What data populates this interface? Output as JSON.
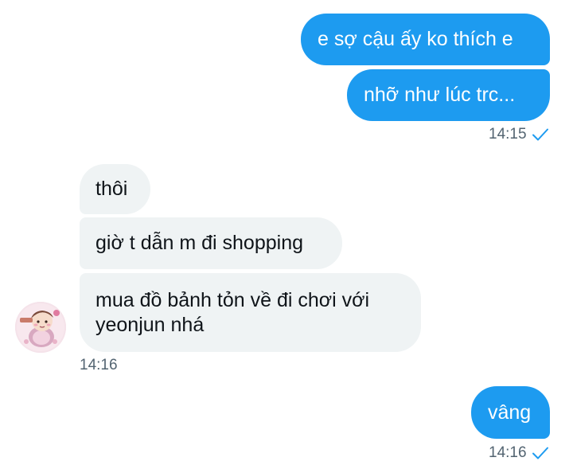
{
  "messages": {
    "m1": "e sợ cậu ấy ko thích e",
    "m2": "nhỡ như lúc trc...",
    "t1": "14:15",
    "r1": "thôi",
    "r2": "giờ t dẫn m đi shopping",
    "r3": "mua đồ bảnh tỏn về đi chơi với yeonjun nhá",
    "t2": "14:16",
    "m3": "vâng",
    "t3": "14:16"
  },
  "colors": {
    "sent_bubble": "#1d9bf0",
    "received_bubble": "#eff3f4",
    "timestamp": "#536471",
    "read_check": "#1d9bf0"
  },
  "icons": {
    "read_receipt": "checkmark-icon",
    "avatar": "avatar"
  }
}
